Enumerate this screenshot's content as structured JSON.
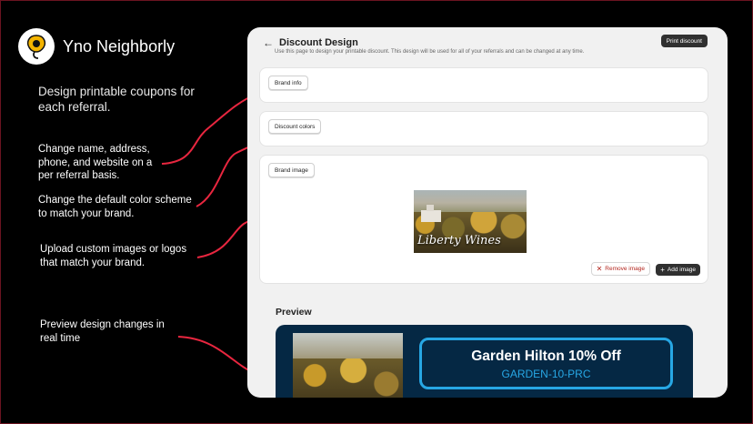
{
  "brand": {
    "name": "Yno Neighborly"
  },
  "annotations": {
    "intro": [
      "Design printable coupons for",
      "each referral."
    ],
    "brand_info": [
      "Change name, address,",
      "phone, and website on a",
      "per referral basis."
    ],
    "colors": [
      "Change the default color scheme",
      "to match your brand."
    ],
    "images": [
      "Upload custom images or logos",
      "that match your brand."
    ],
    "preview": [
      "Preview design changes in",
      "real time"
    ]
  },
  "app": {
    "title": "Discount Design",
    "subtitle": "Use this page to design your printable discount. This design will be used for all of your referrals and can be changed at any time.",
    "print_label": "Print discount",
    "sections": {
      "brand_info": "Brand info",
      "discount_colors": "Discount colors",
      "brand_image": "Brand image"
    },
    "brand_image_text": "Liberty Wines",
    "remove_label": "Remove image",
    "add_label": "Add image",
    "preview_label": "Preview",
    "coupon": {
      "title": "Garden Hilton 10% Off",
      "code": "GARDEN-10-PRC"
    }
  },
  "colors": {
    "accent": "#e8263f",
    "coupon_bg": "#052844",
    "coupon_border": "#27a7e4",
    "primary_button": "#303030"
  }
}
